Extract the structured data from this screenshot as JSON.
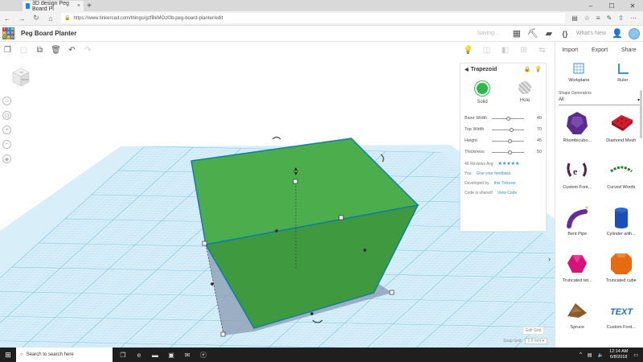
{
  "browser": {
    "tab_title": "3D design Peg Board Pl",
    "tab_close": "×",
    "new_tab": "+",
    "url": "https://www.tinkercad.com/things/gzfBkMOzl0b-peg-board-planter/edit",
    "window_controls": [
      "–",
      "☐",
      "✕"
    ]
  },
  "header": {
    "logo_letters": [
      "T",
      "I",
      "N",
      "K",
      "E",
      "R",
      "C",
      "A",
      "D"
    ],
    "logo_colors": [
      "#e53935",
      "#1e88e5",
      "#43a047",
      "#fb8c00",
      "#1e88e5",
      "#e53935",
      "#43a047",
      "#fb8c00",
      "#1e88e5"
    ],
    "project_title": "Peg Board Planter",
    "saving_text": "Saving...",
    "whats_new": "What's New"
  },
  "right_panel": {
    "import_label": "Import",
    "export_label": "Export",
    "share_label": "Share",
    "workplane_label": "Workplane",
    "ruler_label": "Ruler",
    "shape_generators_label": "Shape Generators",
    "filter_value": "All",
    "shapes": [
      {
        "label": "Rhombicubo...",
        "icon": "rhombicuboctahedron-icon",
        "color": "#5b2d8a"
      },
      {
        "label": "Diamond Mesh",
        "icon": "diamond-mesh-icon",
        "color": "#d11a2a"
      },
      {
        "label": "Custom Font...",
        "icon": "custom-font-icon",
        "color": "#5b1f4a"
      },
      {
        "label": "Curved Words",
        "icon": "curved-words-icon",
        "color": "#2e7d32"
      },
      {
        "label": "Bent Pipe",
        "icon": "bent-pipe-icon",
        "color": "#6a2a9c"
      },
      {
        "label": "Cylinder with...",
        "icon": "cylinder-icon",
        "color": "#1a4fb8"
      },
      {
        "label": "Truncated tet...",
        "icon": "truncated-tetrahedron-icon",
        "color": "#d8127a"
      },
      {
        "label": "Truncated cube",
        "icon": "truncated-cube-icon",
        "color": "#e66a12"
      },
      {
        "label": "Spruce",
        "icon": "spruce-icon",
        "color": "#8b5a2b"
      },
      {
        "label": "Custom Font...",
        "icon": "custom-font-text-icon",
        "color": "#1e73be"
      }
    ]
  },
  "inspector": {
    "shape_name": "Trapezoid",
    "solid_label": "Solid",
    "hole_label": "Hole",
    "params": [
      {
        "label": "Base Width",
        "value": "40",
        "fraction": 0.5
      },
      {
        "label": "Top Width",
        "value": "70",
        "fraction": 0.6
      },
      {
        "label": "Height",
        "value": "45",
        "fraction": 0.55
      },
      {
        "label": "Thickness",
        "value": "50",
        "fraction": 0.55
      }
    ],
    "reviews_label": "46 Reviews Avg",
    "stars": "★★★★★",
    "you_label": "You",
    "feedback_link": "Give your feedback",
    "developed_label": "Developed by",
    "developer": "this Tinkerer",
    "code_label": "Code is shared!",
    "view_code": "View Code"
  },
  "workspace": {
    "edit_grid": "Edit Grid",
    "snap_grid_label": "Snap Grid",
    "snap_grid_value": "1.0 mm ▾",
    "viewcube_top": "TOP",
    "viewcube_front": "FRONT"
  },
  "taskbar": {
    "search_placeholder": "Search to search here",
    "time": "12:14 AM",
    "date": "6/8/2018"
  }
}
